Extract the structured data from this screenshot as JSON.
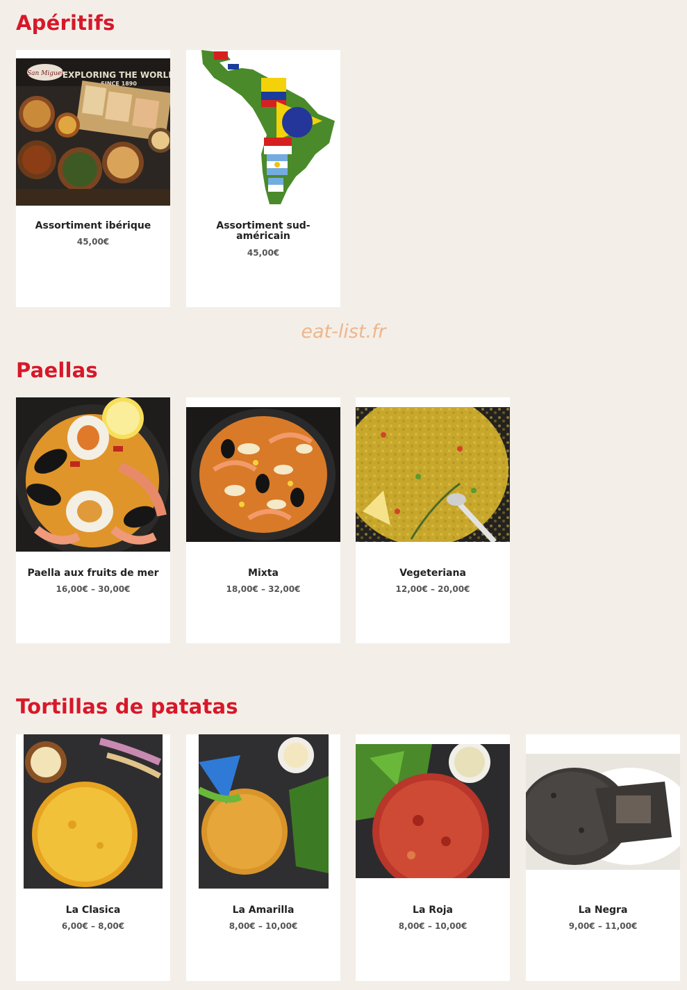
{
  "sections": {
    "aperitifs": {
      "title": "Apéritifs",
      "items": [
        {
          "name": "Assortiment ibérique",
          "price": "45,00€"
        },
        {
          "name": "Assortiment sud-américain",
          "price": "45,00€"
        }
      ]
    },
    "paellas": {
      "title": "Paellas",
      "items": [
        {
          "name": "Paella aux fruits de mer",
          "price": "16,00€ – 30,00€"
        },
        {
          "name": "Mixta",
          "price": "18,00€ – 32,00€"
        },
        {
          "name": "Vegeteriana",
          "price": "12,00€ – 20,00€"
        }
      ]
    },
    "tortillas": {
      "title": "Tortillas de patatas",
      "items": [
        {
          "name": "La Clasica",
          "price": "6,00€ – 8,00€"
        },
        {
          "name": "La Amarilla",
          "price": "8,00€ – 10,00€"
        },
        {
          "name": "La Roja",
          "price": "8,00€ – 10,00€"
        },
        {
          "name": "La Negra",
          "price": "9,00€ – 11,00€"
        }
      ]
    }
  },
  "image_text": {
    "board_slogan": "EXPLORING THE WORLD",
    "board_since": "SINCE 1890",
    "board_brand": "San Miguel"
  },
  "watermark": "eat-list.fr",
  "colors": {
    "background": "#f3efe8",
    "section_title": "#d7182a",
    "card": "#ffffff",
    "watermark": "#efb58c"
  }
}
